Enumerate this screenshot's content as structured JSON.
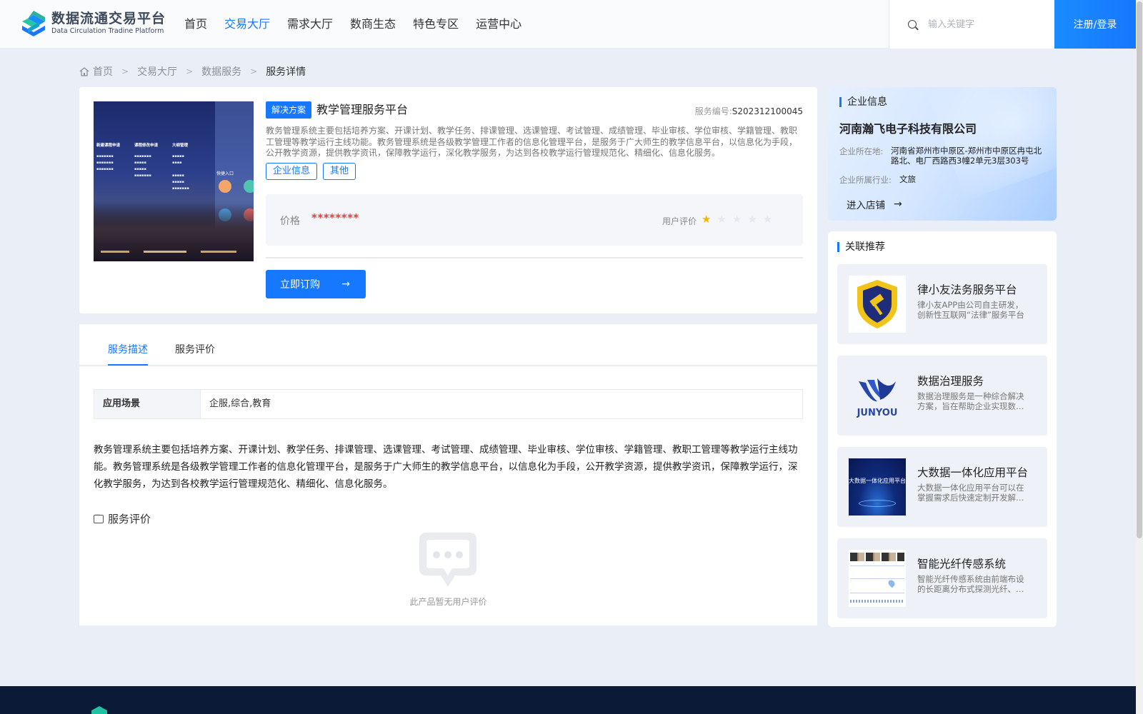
{
  "header": {
    "logo_cn": "数据流通交易平台",
    "logo_en": "Data Circulation Tradine Platform",
    "nav": [
      "首页",
      "交易大厅",
      "需求大厅",
      "数商生态",
      "特色专区",
      "运营中心"
    ],
    "nav_active": "交易大厅",
    "search_placeholder": "输入关键字",
    "login_label": "注册/登录"
  },
  "breadcrumb": [
    "首页",
    "交易大厅",
    "数据服务",
    "服务详情"
  ],
  "product": {
    "badge": "解决方案",
    "title": "教学管理服务平台",
    "service_no_label": "服务编号:",
    "service_no": "S202312100045",
    "description": "教务管理系统主要包括培养方案、开课计划、教学任务、排课管理、选课管理、考试管理、成绩管理、毕业审核、学位审核、学籍管理、教职工管理等教学运行主线功能。教务管理系统是各级教学管理工作者的信息化管理平台，是服务于广大师生的教学信息平台，以信息化为手段，公开教学资源，提供教学资讯，保障教学运行，深化教学服务，为达到各校教学运行管理规范化、精细化、信息化服务。",
    "tags": [
      "企业信息",
      "其他"
    ],
    "price_label": "价格",
    "price_value": "********",
    "rating_label": "用户评价",
    "rating": 1,
    "rating_max": 5,
    "order_label": "立即订购",
    "image_text": {
      "col1_head": "新建课程申请",
      "col2_head": "课程修改申请",
      "col3_head": "大纲管理",
      "entry": "快捷入口"
    }
  },
  "detail": {
    "tabs": [
      "服务描述",
      "服务评价"
    ],
    "active_tab": "服务描述",
    "scenario_key": "应用场景",
    "scenario_value": "企服,综合,教育",
    "long_description": "教务管理系统主要包括培养方案、开课计划、教学任务、排课管理、选课管理、考试管理、成绩管理、毕业审核、学位审核、学籍管理、教职工管理等教学运行主线功能。教务管理系统是各级教学管理工作者的信息化管理平台，是服务于广大师生的教学信息平台，以信息化为手段，公开教学资源，提供教学资讯，保障教学运行，深化教学服务，为达到各校教学运行管理规范化、精细化、信息化服务。",
    "review_heading": "服务评价",
    "empty_text": "此产品暂无用户评价"
  },
  "company": {
    "heading": "企业信息",
    "name": "河南瀚飞电子科技有限公司",
    "location_label": "企业所在地:",
    "location": "河南省郑州市中原区-郑州市中原区冉屯北路北、电厂西路西3幢2单元3层303号",
    "industry_label": "企业所属行业:",
    "industry": "文旅",
    "enter_label": "进入店铺"
  },
  "related": {
    "heading": "关联推荐",
    "items": [
      {
        "title": "律小友法务服务平台",
        "desc": "律小友APP由公司自主研发，创新性互联网“法律”服务平台",
        "thumb": "shield-logo"
      },
      {
        "title": "数据治理服务",
        "desc": "数据治理服务是一种综合解决方案，旨在帮助企业实现数据的有效管理",
        "thumb": "junyou-logo",
        "thumb_text": "JUNYOU"
      },
      {
        "title": "大数据一体化应用平台",
        "desc": "大数据一体化应用平台可以在掌握需求后快速定制开发解决方案",
        "thumb": "bigdata-banner",
        "thumb_text": "大数据一体化应用平台"
      },
      {
        "title": "智能光纤传感系统",
        "desc": "智能光纤传感系统由前端布设的长距离分布式探测光纤、解调设备组成",
        "thumb": "fiber-screenshot"
      }
    ]
  },
  "colors": {
    "accent": "#1677ff",
    "price": "#ee3b3b",
    "star": "#f7b500",
    "footer": "#0b1a36"
  }
}
